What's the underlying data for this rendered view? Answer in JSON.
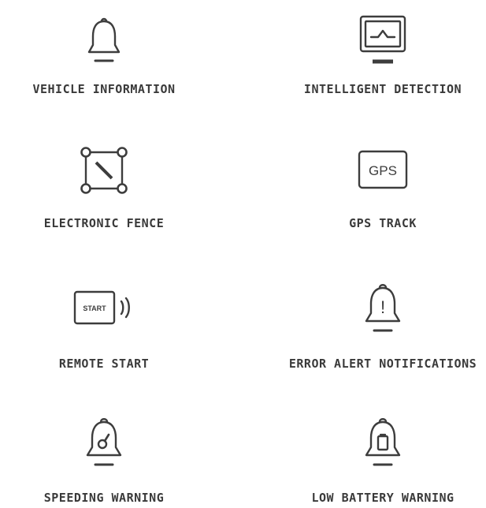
{
  "features": [
    {
      "label": "VEHICLE INFORMATION",
      "icon": "bell-icon"
    },
    {
      "label": "INTELLIGENT DETECTION",
      "icon": "monitor-waveform-icon"
    },
    {
      "label": "ELECTRONIC FENCE",
      "icon": "fence-area-icon"
    },
    {
      "label": "GPS TRACK",
      "icon": "gps-icon",
      "icon_text": "GPS"
    },
    {
      "label": "REMOTE START",
      "icon": "remote-start-icon",
      "icon_text": "START"
    },
    {
      "label": "ERROR ALERT NOTIFICATIONS",
      "icon": "alert-bell-icon",
      "icon_text": "!"
    },
    {
      "label": "SPEEDING WARNING",
      "icon": "speed-bell-icon"
    },
    {
      "label": "LOW BATTERY WARNING",
      "icon": "battery-bell-icon"
    }
  ],
  "colors": {
    "icon": "#3d3d3d",
    "text": "#3a3a3a",
    "background": "#ffffff"
  }
}
